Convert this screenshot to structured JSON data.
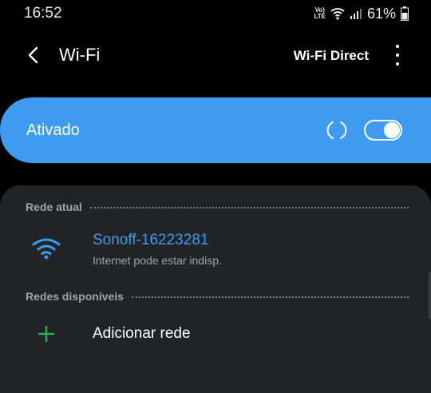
{
  "status_bar": {
    "time": "16:52",
    "volte_top": "Vo)",
    "volte_bottom": "LTE",
    "battery": "61%"
  },
  "app_bar": {
    "title": "Wi-Fi",
    "wifi_direct_label": "Wi-Fi Direct",
    "back_icon": "back-arrow-icon",
    "more_icon": "more-vert-icon"
  },
  "wifi_toggle": {
    "label": "Ativado",
    "state": "on",
    "accent": "#3e9bf1"
  },
  "current_network": {
    "header": "Rede atual",
    "name": "Sonoff-16223281",
    "status": "Internet pode estar indisp.",
    "icon": "wifi-icon"
  },
  "available_networks": {
    "header": "Redes disponíveis",
    "add_label": "Adicionar rede",
    "add_icon": "plus-icon",
    "add_icon_color": "#2db34a"
  }
}
